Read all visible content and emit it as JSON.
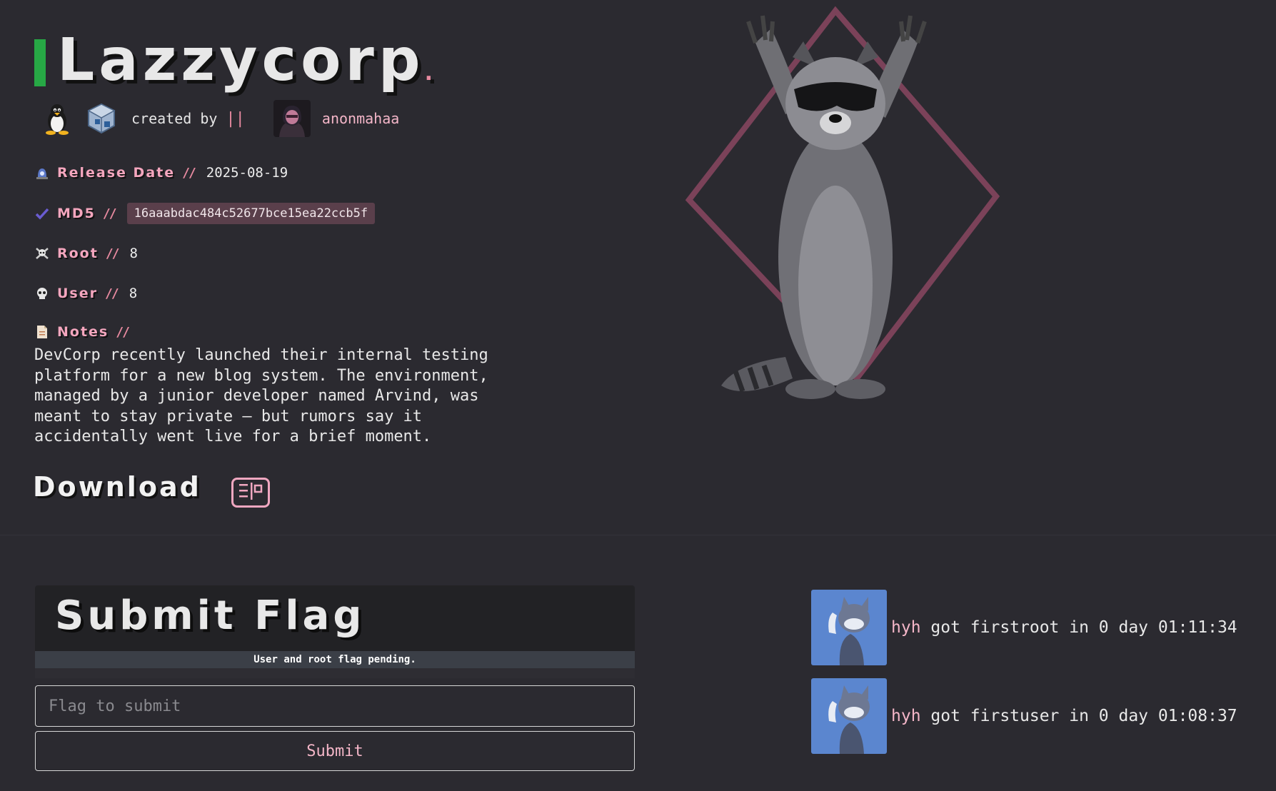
{
  "machine": {
    "title": "Lazzycorp",
    "title_dot": ".",
    "created_by_label": "created by",
    "created_by_sep": "||",
    "author": "anonmahaa"
  },
  "info": {
    "release_date": {
      "label": "Release Date",
      "sep": "//",
      "value": "2025-08-19"
    },
    "md5": {
      "label": "MD5",
      "sep": "//",
      "value": "16aaabdac484c52677bce15ea22ccb5f"
    },
    "root": {
      "label": "Root",
      "sep": "//",
      "value": "8"
    },
    "user": {
      "label": "User",
      "sep": "//",
      "value": "8"
    },
    "notes": {
      "label": "Notes",
      "sep": "//",
      "value": "DevCorp recently launched their internal testing\nplatform for a new blog system. The environment,\nmanaged by a junior developer named Arvind, was\nmeant to stay private — but rumors say it\naccidentally went live for a brief moment."
    }
  },
  "download": {
    "label": "Download"
  },
  "flag": {
    "title": "Submit Flag",
    "status": "User and root flag pending.",
    "placeholder": "Flag to submit",
    "submit_label": "Submit"
  },
  "bloods": [
    {
      "user": "hyh",
      "text": " got firstroot in 0 day 01:11:34"
    },
    {
      "user": "hyh",
      "text": " got firstuser in 0 day 01:08:37"
    }
  ],
  "colors": {
    "accent_pink": "#f4a6be",
    "title_bar_green": "#27a845",
    "background": "#2b2a30"
  },
  "icons": {
    "os": "linux-tux-icon",
    "platform": "virtualbox-icon",
    "release_date": "alarm-light-icon",
    "md5": "checkmark-icon",
    "root": "skull-crossbones-icon",
    "user": "skull-icon",
    "notes": "document-icon",
    "download": "download-icon"
  }
}
